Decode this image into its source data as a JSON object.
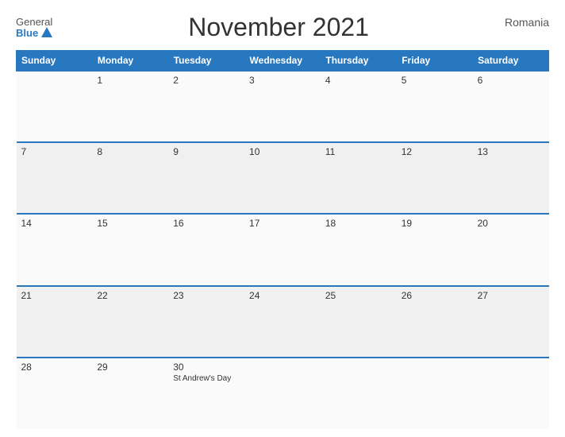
{
  "header": {
    "logo_general": "General",
    "logo_blue": "Blue",
    "title": "November 2021",
    "country": "Romania"
  },
  "weekdays": [
    "Sunday",
    "Monday",
    "Tuesday",
    "Wednesday",
    "Thursday",
    "Friday",
    "Saturday"
  ],
  "weeks": [
    [
      {
        "day": "",
        "holiday": ""
      },
      {
        "day": "1",
        "holiday": ""
      },
      {
        "day": "2",
        "holiday": ""
      },
      {
        "day": "3",
        "holiday": ""
      },
      {
        "day": "4",
        "holiday": ""
      },
      {
        "day": "5",
        "holiday": ""
      },
      {
        "day": "6",
        "holiday": ""
      }
    ],
    [
      {
        "day": "7",
        "holiday": ""
      },
      {
        "day": "8",
        "holiday": ""
      },
      {
        "day": "9",
        "holiday": ""
      },
      {
        "day": "10",
        "holiday": ""
      },
      {
        "day": "11",
        "holiday": ""
      },
      {
        "day": "12",
        "holiday": ""
      },
      {
        "day": "13",
        "holiday": ""
      }
    ],
    [
      {
        "day": "14",
        "holiday": ""
      },
      {
        "day": "15",
        "holiday": ""
      },
      {
        "day": "16",
        "holiday": ""
      },
      {
        "day": "17",
        "holiday": ""
      },
      {
        "day": "18",
        "holiday": ""
      },
      {
        "day": "19",
        "holiday": ""
      },
      {
        "day": "20",
        "holiday": ""
      }
    ],
    [
      {
        "day": "21",
        "holiday": ""
      },
      {
        "day": "22",
        "holiday": ""
      },
      {
        "day": "23",
        "holiday": ""
      },
      {
        "day": "24",
        "holiday": ""
      },
      {
        "day": "25",
        "holiday": ""
      },
      {
        "day": "26",
        "holiday": ""
      },
      {
        "day": "27",
        "holiday": ""
      }
    ],
    [
      {
        "day": "28",
        "holiday": ""
      },
      {
        "day": "29",
        "holiday": ""
      },
      {
        "day": "30",
        "holiday": "St Andrew's Day"
      },
      {
        "day": "",
        "holiday": ""
      },
      {
        "day": "",
        "holiday": ""
      },
      {
        "day": "",
        "holiday": ""
      },
      {
        "day": "",
        "holiday": ""
      }
    ]
  ]
}
